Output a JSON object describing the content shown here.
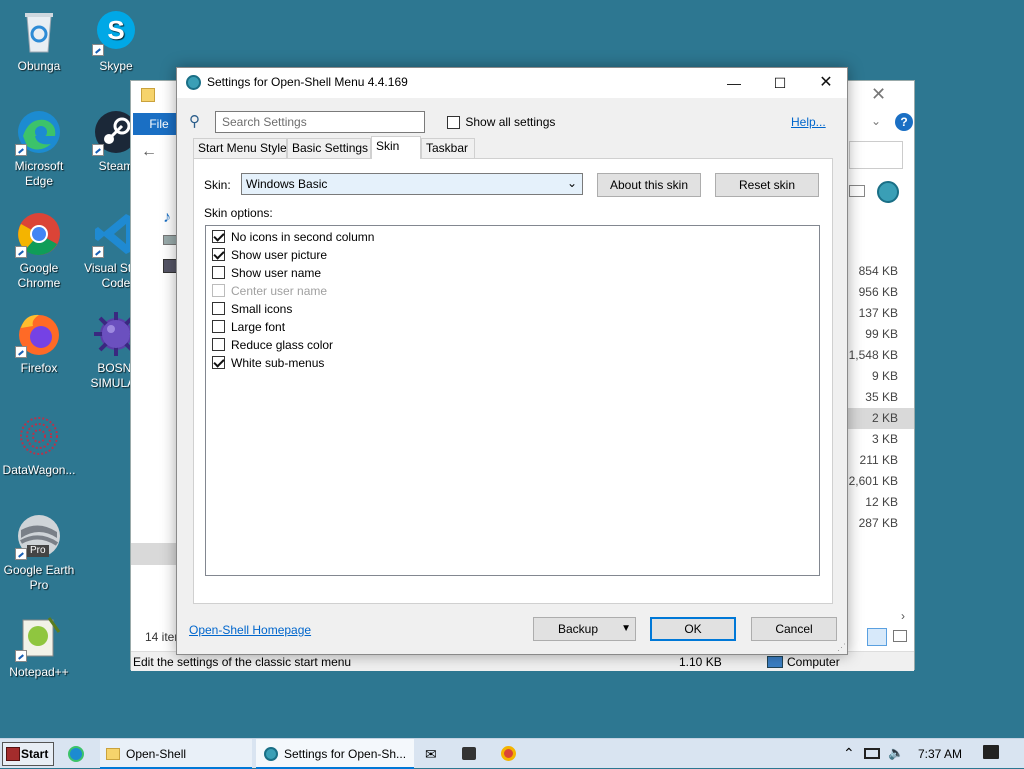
{
  "desktop": {
    "icons": [
      {
        "label": "Obunga",
        "icon": "recycle-bin-icon"
      },
      {
        "label": "Skype",
        "icon": "skype-icon"
      },
      {
        "label": "Microsoft Edge",
        "icon": "edge-icon"
      },
      {
        "label": "Steam",
        "icon": "steam-icon"
      },
      {
        "label": "Google Chrome",
        "icon": "chrome-icon"
      },
      {
        "label": "Visual Stu... Code",
        "icon": "vscode-icon"
      },
      {
        "label": "Firefox",
        "icon": "firefox-icon"
      },
      {
        "label": "BOSNI SIMULAT",
        "icon": "bosni-simulator-icon"
      },
      {
        "label": "DataWagon...",
        "icon": "datawagon-icon"
      },
      {
        "label": "Google Earth Pro",
        "icon": "google-earth-pro-icon"
      },
      {
        "label": "Notepad++",
        "icon": "notepad-plus-plus-icon"
      }
    ],
    "earth_badge": "Pro"
  },
  "explorer": {
    "file_tab": "File",
    "status_left": "Edit the settings of the classic start menu",
    "status_size": "1.10 KB",
    "status_computer": "Computer",
    "item_count": "14 iter",
    "sizes": [
      "854 KB",
      "956 KB",
      "137 KB",
      "99 KB",
      "1,548 KB",
      "9 KB",
      "35 KB",
      "2 KB",
      "3 KB",
      "211 KB",
      "2,601 KB",
      "12 KB",
      "287 KB"
    ]
  },
  "dialog": {
    "title": "Settings for Open-Shell Menu 4.4.169",
    "search_placeholder": "Search Settings",
    "show_all_label": "Show all settings",
    "help_label": "Help...",
    "tabs": [
      {
        "label": "Start Menu Style"
      },
      {
        "label": "Basic Settings"
      },
      {
        "label": "Skin"
      },
      {
        "label": "Taskbar"
      }
    ],
    "skin_label": "Skin:",
    "skin_value": "Windows Basic",
    "about_skin_label": "About this skin",
    "reset_skin_label": "Reset skin",
    "skin_options_label": "Skin options:",
    "options": [
      {
        "label": "No icons in second column",
        "checked": true,
        "enabled": true
      },
      {
        "label": "Show user picture",
        "checked": true,
        "enabled": true
      },
      {
        "label": "Show user name",
        "checked": false,
        "enabled": true
      },
      {
        "label": "Center user name",
        "checked": false,
        "enabled": false
      },
      {
        "label": "Small icons",
        "checked": false,
        "enabled": true
      },
      {
        "label": "Large font",
        "checked": false,
        "enabled": true
      },
      {
        "label": "Reduce glass color",
        "checked": false,
        "enabled": true
      },
      {
        "label": "White sub-menus",
        "checked": true,
        "enabled": true
      }
    ],
    "homepage_link": "Open-Shell Homepage",
    "backup_label": "Backup",
    "ok_label": "OK",
    "cancel_label": "Cancel"
  },
  "taskbar": {
    "start_label": "Start",
    "open_shell_label": "Open-Shell",
    "settings_label": "Settings for Open-Sh...",
    "time": "7:37 AM"
  },
  "colors": {
    "desktop": "#2d7791",
    "accent": "#0078d7",
    "link": "#0066cc"
  }
}
